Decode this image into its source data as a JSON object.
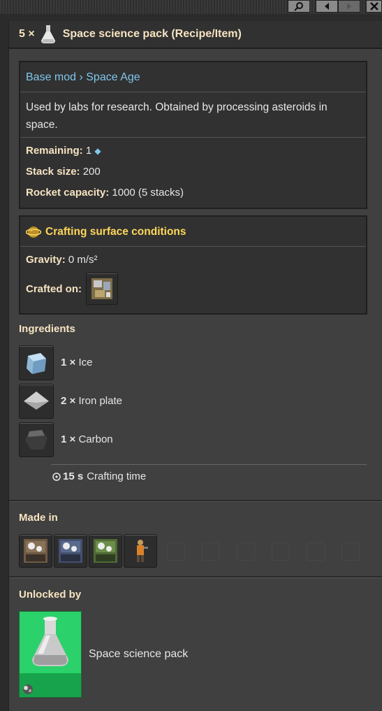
{
  "header": {
    "count": "5 ×",
    "title": "Space science pack (Recipe/Item)"
  },
  "info": {
    "breadcrumb": "Base mod › Space Age",
    "description": "Used by labs for research. Obtained by processing asteroids in space.",
    "remaining_label": "Remaining:",
    "remaining_value": "1",
    "stack_label": "Stack size:",
    "stack_value": "200",
    "rocket_label": "Rocket capacity:",
    "rocket_value": "1000 (5 stacks)"
  },
  "surface": {
    "title": "Crafting surface conditions",
    "gravity_label": "Gravity:",
    "gravity_value": "0 m/s²",
    "crafted_on_label": "Crafted on:"
  },
  "ingredients": {
    "title": "Ingredients",
    "items": [
      {
        "amount": "1 ×",
        "name": "Ice",
        "icon": "ice-icon"
      },
      {
        "amount": "2 ×",
        "name": "Iron plate",
        "icon": "iron-plate-icon"
      },
      {
        "amount": "1 ×",
        "name": "Carbon",
        "icon": "carbon-icon"
      }
    ],
    "time_value": "15 s",
    "time_label": "Crafting time"
  },
  "made_in": {
    "title": "Made in",
    "machines": [
      "assembling-machine-1-icon",
      "assembling-machine-2-icon",
      "assembling-machine-3-icon",
      "engineer-character-icon"
    ]
  },
  "unlocked_by": {
    "title": "Unlocked by",
    "tech_name": "Space science pack"
  },
  "colors": {
    "accent": "#f6e3c1",
    "link": "#7fc6ec",
    "surface_title": "#ffd75a",
    "tech_green": "#2bd16a"
  }
}
